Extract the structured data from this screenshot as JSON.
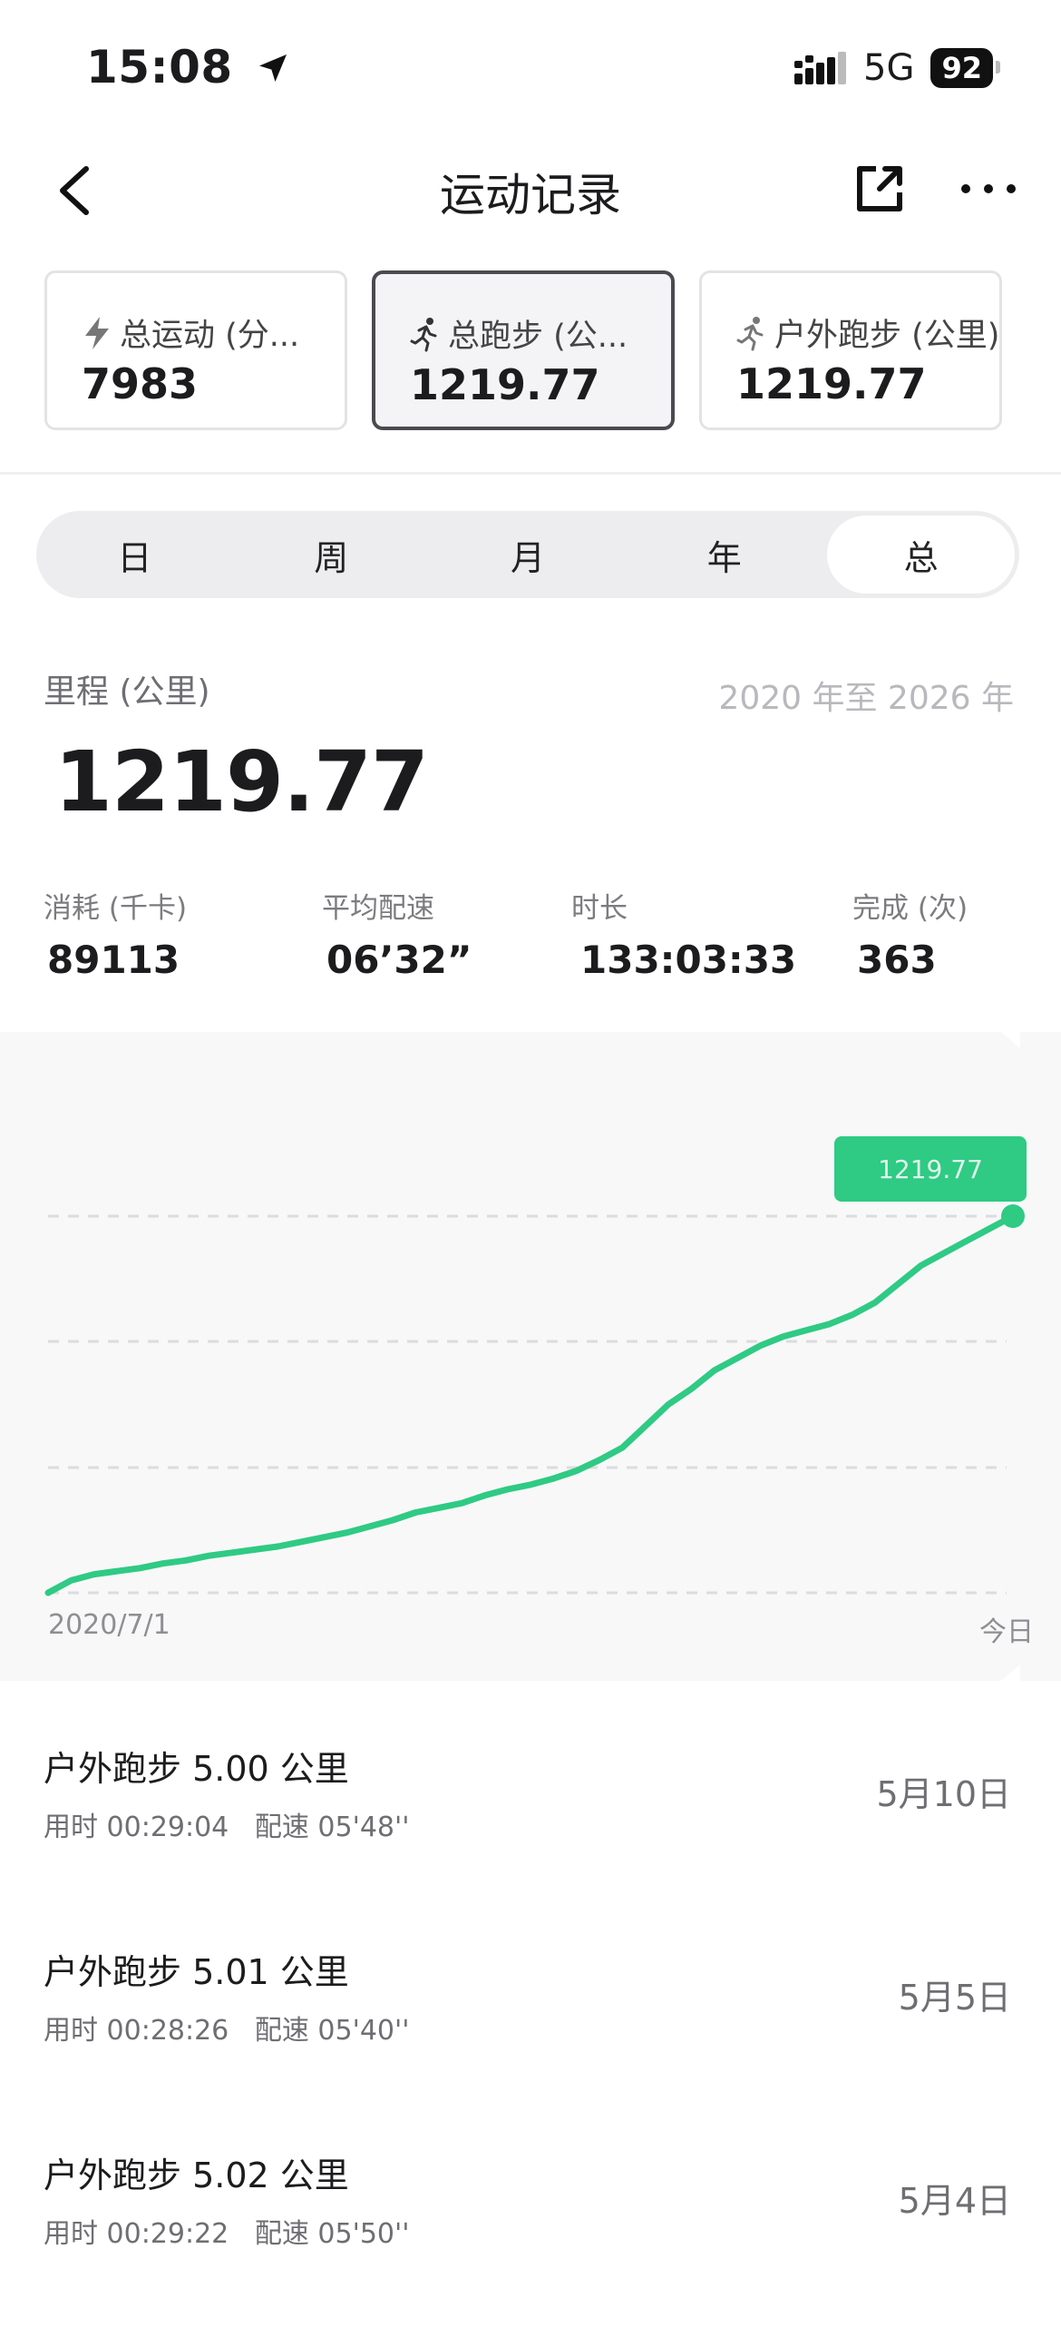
{
  "status": {
    "time": "15:08",
    "network": "5G",
    "battery": "92"
  },
  "nav": {
    "title": "运动记录"
  },
  "cards": [
    {
      "label": "总运动 (分...",
      "value": "7983",
      "icon": "bolt-icon"
    },
    {
      "label": "总跑步 (公...",
      "value": "1219.77",
      "icon": "runner-icon"
    },
    {
      "label": "户外跑步 (公里)",
      "value": "1219.77",
      "icon": "runner-icon"
    }
  ],
  "segments": [
    "日",
    "周",
    "月",
    "年",
    "总"
  ],
  "active_segment": "总",
  "summary": {
    "label": "里程 (公里)",
    "range": "2020 年至 2026 年",
    "value": "1219.77"
  },
  "stats": [
    {
      "label": "消耗 (千卡)",
      "value": "89113"
    },
    {
      "label": "平均配速",
      "value": "06’32”"
    },
    {
      "label": "时长",
      "value": "133:03:33"
    },
    {
      "label": "完成 (次)",
      "value": "363"
    }
  ],
  "chart_data": {
    "type": "line",
    "x_start_label": "2020/7/1",
    "x_end_label": "今日",
    "tooltip": "1219.77",
    "series": [
      {
        "color": "#2fca84",
        "values": [
          0,
          40,
          60,
          70,
          80,
          95,
          105,
          120,
          130,
          140,
          150,
          165,
          180,
          195,
          215,
          235,
          260,
          275,
          290,
          315,
          335,
          350,
          370,
          395,
          430,
          470,
          540,
          610,
          660,
          720,
          760,
          800,
          830,
          850,
          870,
          900,
          940,
          1000,
          1060,
          1100,
          1140,
          1180,
          1219.77
        ]
      }
    ]
  },
  "records": [
    {
      "title": "户外跑步  5.00 公里",
      "sub": "用时 00:29:04   配速 05'48''",
      "date": "5月10日"
    },
    {
      "title": "户外跑步  5.01 公里",
      "sub": "用时 00:28:26   配速 05'40''",
      "date": "5月5日"
    },
    {
      "title": "户外跑步  5.02 公里",
      "sub": "用时 00:29:22   配速 05'50''",
      "date": "5月4日"
    }
  ]
}
